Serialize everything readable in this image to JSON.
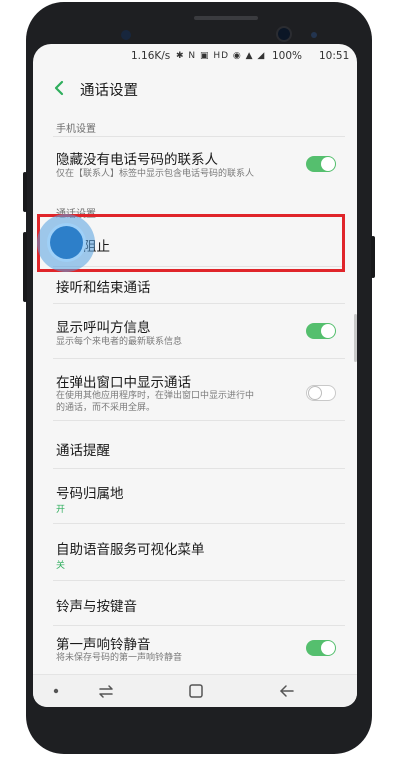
{
  "status_bar": {
    "speed": "1.16K/s",
    "icons": "✱ N ▣ HD ◉ ▲ ◢",
    "battery": "100%",
    "time": "10:51"
  },
  "header": {
    "title": "通话设置"
  },
  "sections": {
    "phone_settings": "手机设置",
    "call_settings": "通话设置"
  },
  "items": {
    "hide_contacts": {
      "title": "隐藏没有电话号码的联系人",
      "subtitle": "仅在【联系人】标签中显示包含电话号码的联系人",
      "toggle": "on"
    },
    "call_block": {
      "title": "来电阻止"
    },
    "answer_end": {
      "title": "接听和结束通话"
    },
    "caller_info": {
      "title": "显示呼叫方信息",
      "subtitle": "显示每个来电者的最新联系信息",
      "toggle": "on"
    },
    "popup_call": {
      "title": "在弹出窗口中显示通话",
      "subtitle_line1": "在使用其他应用程序时，在弹出窗口中显示进行中",
      "subtitle_line2": "的通话，而不采用全屏。",
      "toggle": "off"
    },
    "call_alerts": {
      "title": "通话提醒"
    },
    "number_location": {
      "title": "号码归属地",
      "value": "开"
    },
    "visual_ivr": {
      "title": "自助语音服务可视化菜单",
      "value": "关"
    },
    "ringtones": {
      "title": "铃声与按键音"
    },
    "first_ring_mute": {
      "title": "第一声响铃静音",
      "subtitle": "将未保存号码的第一声响铃静音",
      "toggle": "on"
    }
  },
  "colors": {
    "accent_green": "#55bf6e",
    "highlight_red": "#e0252a",
    "tap_blue": "#2d7fc9"
  }
}
